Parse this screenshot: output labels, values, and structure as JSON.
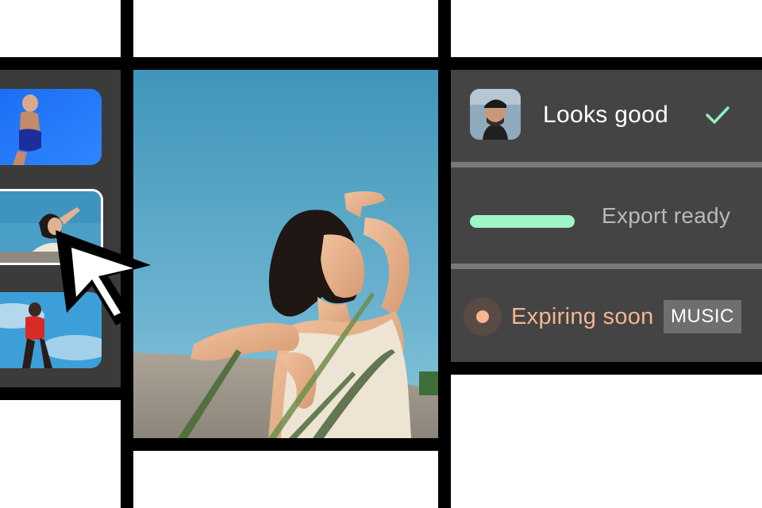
{
  "review": {
    "status_text": "Looks good",
    "status_color": "#8ff0b8"
  },
  "export": {
    "label": "Export ready",
    "progress": 1.0,
    "bar_color": "#9ff5c8"
  },
  "expiry": {
    "label": "Expiring soon",
    "badge": "MUSIC",
    "accent_color": "#f6b493"
  },
  "icons": {
    "check": "checkmark-icon",
    "cursor": "mouse-pointer-icon",
    "dot": "status-dot-icon"
  }
}
